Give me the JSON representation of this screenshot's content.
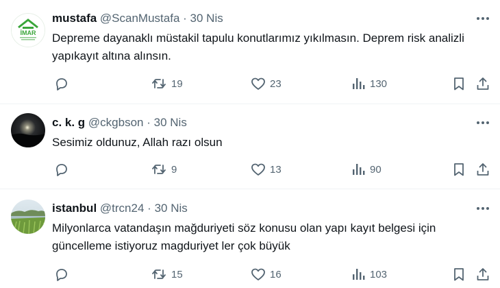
{
  "tweets": [
    {
      "name": "mustafa",
      "handle": "@ScanMustafa",
      "separator": "·",
      "date": "30 Nis",
      "logo_text": "İMAR",
      "text": "Depreme dayanaklı müstakil tapulu konutlarımız yıkılmasın. Deprem risk analizli yapıkayıt altına alınsın.",
      "replies": "",
      "retweets": "19",
      "likes": "23",
      "views": "130"
    },
    {
      "name": "c. k. g",
      "handle": "@ckgbson",
      "separator": "·",
      "date": "30 Nis",
      "text": "Sesimiz oldunuz, Allah razı olsun",
      "replies": "",
      "retweets": "9",
      "likes": "13",
      "views": "90"
    },
    {
      "name": "istanbul",
      "handle": "@trcn24",
      "separator": "·",
      "date": "30 Nis",
      "text": "Milyonlarca vatandaşın mağduriyeti söz konusu olan yapı kayıt belgesi için güncelleme istiyoruz magduriyet ler çok büyük",
      "replies": "",
      "retweets": "15",
      "likes": "16",
      "views": "103"
    }
  ],
  "icons": {
    "reply": "reply-icon",
    "retweet": "retweet-icon",
    "like": "heart-icon",
    "views": "views-icon",
    "bookmark": "bookmark-icon",
    "share": "share-icon",
    "more": "more-icon"
  },
  "colors": {
    "text": "#0f1419",
    "secondary": "#536471",
    "divider": "#eff3f4",
    "logo_green": "#3aa63a"
  }
}
